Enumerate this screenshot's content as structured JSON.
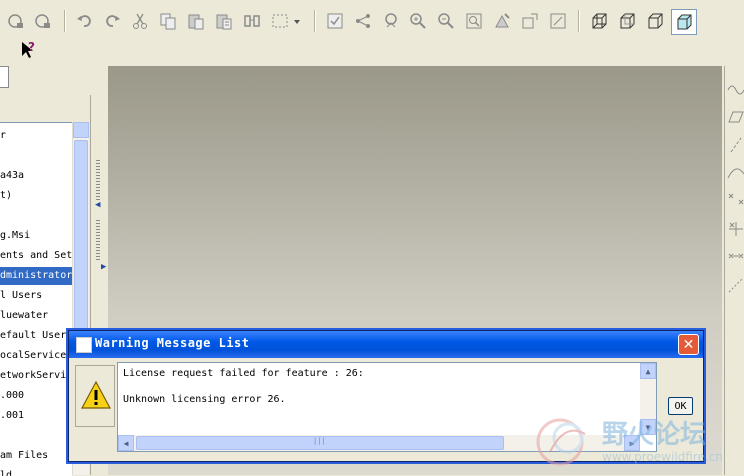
{
  "toolbar": {
    "icons": [
      "open-icon",
      "save-icon",
      "undo-icon",
      "redo-icon",
      "cut-icon",
      "copy-icon",
      "paste-icon",
      "paste-special-icon",
      "find-icon",
      "select-box-icon",
      "dropdown-icon",
      "regenerate-icon",
      "network-icon",
      "feature-icon",
      "zoom-in-icon",
      "zoom-out-icon",
      "refit-icon",
      "repaint-icon",
      "layers-icon",
      "datum-icon",
      "wireframe-icon",
      "hidden-line-icon",
      "no-hidden-icon",
      "shaded-icon"
    ]
  },
  "toolbar2": {
    "help_icon": "context-help-icon",
    "help_glyph": "?"
  },
  "tree": {
    "rows": [
      {
        "label": "r"
      },
      {
        "label": ""
      },
      {
        "label": "a43a"
      },
      {
        "label": "t)"
      },
      {
        "label": ""
      },
      {
        "label": "g.Msi"
      },
      {
        "label": "ents and Set"
      },
      {
        "label": "dministrator",
        "selected": true
      },
      {
        "label": "l Users"
      },
      {
        "label": "luewater"
      },
      {
        "label": "efault User"
      },
      {
        "label": "ocalService"
      },
      {
        "label": "etworkServic"
      },
      {
        "label": ".000"
      },
      {
        "label": ".001"
      },
      {
        "label": ""
      },
      {
        "label": "am Files"
      },
      {
        "label": "ld"
      }
    ]
  },
  "dialog": {
    "title": "Warning Message List",
    "messages": [
      "License request failed for feature : 26:",
      "Unknown licensing error 26."
    ],
    "ok_label": "OK",
    "close_glyph": "✕",
    "scroll_up": "▲",
    "scroll_down": "▼",
    "scroll_left": "◀",
    "scroll_right": "▶",
    "hscroll_grip": "|||"
  },
  "watermark": {
    "title": "野火论坛",
    "url": "www.proewildfire.cn"
  },
  "colors": {
    "titlebar": "#0058e6",
    "selection": "#316ac5",
    "close": "#e45b3a"
  }
}
